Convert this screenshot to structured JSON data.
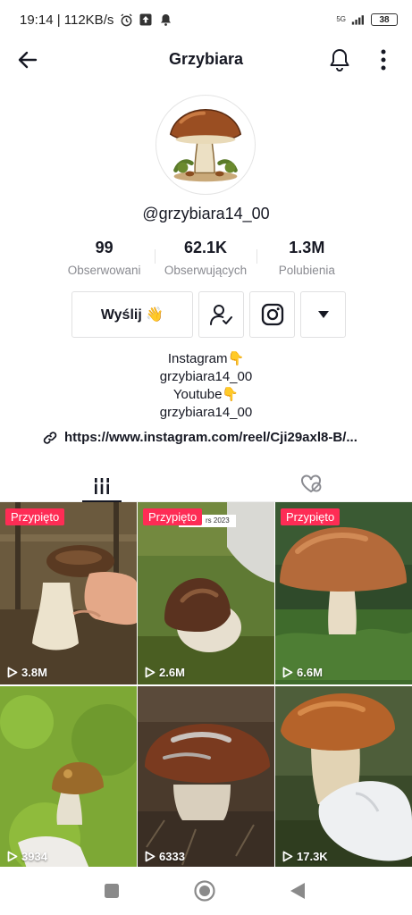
{
  "status_bar": {
    "time": "19:14 | 112KB/s",
    "battery": "38",
    "network": "5G"
  },
  "header": {
    "title": "Grzybiara"
  },
  "profile": {
    "username": "@grzybiara14_00"
  },
  "stats": [
    {
      "value": "99",
      "label": "Obserwowani"
    },
    {
      "value": "62.1K",
      "label": "Obserwujących"
    },
    {
      "value": "1.3M",
      "label": "Polubienia"
    }
  ],
  "actions": {
    "message_label": "Wyślij 👋"
  },
  "bio": [
    "Instagram👇",
    "grzybiara14_00",
    "Youtube👇",
    "grzybiara14_00"
  ],
  "link": "https://www.instagram.com/reel/Cji29axl8-B/...",
  "videos": [
    {
      "pinned_label": "Przypięto",
      "views": "3.8M"
    },
    {
      "pinned_label": "Przypięto",
      "views": "2.6M",
      "overlay_text": "rs 2023"
    },
    {
      "pinned_label": "Przypięto",
      "views": "6.6M"
    },
    {
      "pinned_label": "",
      "views": "3934"
    },
    {
      "pinned_label": "",
      "views": "6333"
    },
    {
      "pinned_label": "",
      "views": "17.3K"
    }
  ],
  "colors": {
    "accent": "#fe2c55",
    "text": "#161823",
    "muted": "#8a8b91"
  }
}
